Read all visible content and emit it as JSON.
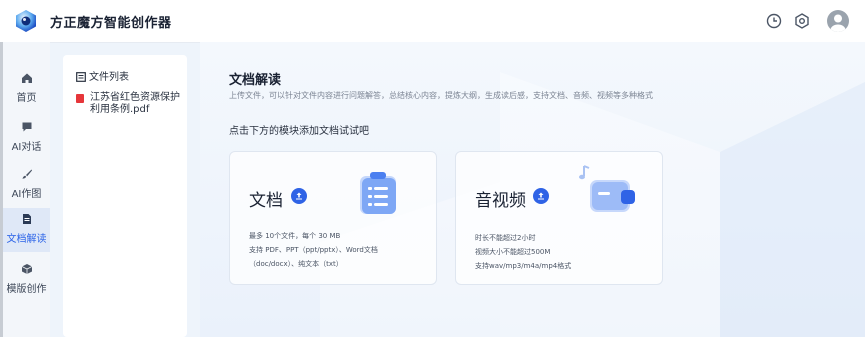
{
  "app": {
    "title": "方正魔方智能创作器"
  },
  "nav": {
    "items": [
      {
        "label": "首页",
        "icon": "home-icon",
        "active": false
      },
      {
        "label": "AI对话",
        "icon": "chat-icon",
        "active": false
      },
      {
        "label": "AI作图",
        "icon": "brush-icon",
        "active": false
      },
      {
        "label": "文档解读",
        "icon": "document-icon",
        "active": true
      },
      {
        "label": "模版创作",
        "icon": "cube-icon",
        "active": false
      }
    ]
  },
  "file_panel": {
    "header": "文件列表",
    "files": [
      {
        "name": "江苏省红色资源保护利用条例.pdf"
      }
    ]
  },
  "main": {
    "title": "文档解读",
    "subtitle": "上传文件，可以针对文件内容进行问题解答，总结核心内容，提炼大纲，生成读后感，支持文档、音频、视频等多种格式",
    "hint": "点击下方的模块添加文档试试吧",
    "cards": [
      {
        "title": "文档",
        "desc": [
          "最多 10个文件，每个 30 MB",
          "支持 PDF、PPT（ppt/pptx）、Word文档",
          "（doc/docx）、纯文本（txt）"
        ]
      },
      {
        "title": "音视频",
        "desc": [
          "时长不能超过2小时",
          "视频大小不能超过500M",
          "支持wav/mp3/m4a/mp4格式"
        ]
      }
    ]
  },
  "colors": {
    "accent": "#2f63e6",
    "pdf": "#e6363a"
  }
}
